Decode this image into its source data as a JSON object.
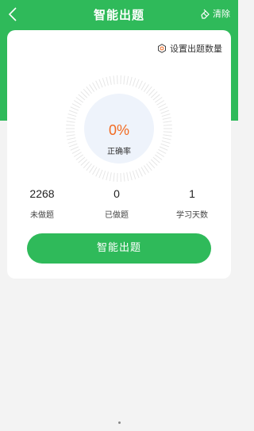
{
  "header": {
    "title": "智能出题",
    "clear_label": "清除"
  },
  "card": {
    "settings_label": "设置出题数量",
    "accuracy_value": "0%",
    "accuracy_label": "正确率",
    "stats": [
      {
        "value": "2268",
        "label": "未做题"
      },
      {
        "value": "0",
        "label": "已做题"
      },
      {
        "value": "1",
        "label": "学习天数"
      }
    ],
    "generate_button": "智能出题"
  },
  "colors": {
    "brand_green": "#2fba5a",
    "accent_orange": "#f26a21"
  },
  "icons": {
    "back": "chevron-left-icon",
    "clear": "eraser-icon",
    "settings": "gear-icon"
  }
}
